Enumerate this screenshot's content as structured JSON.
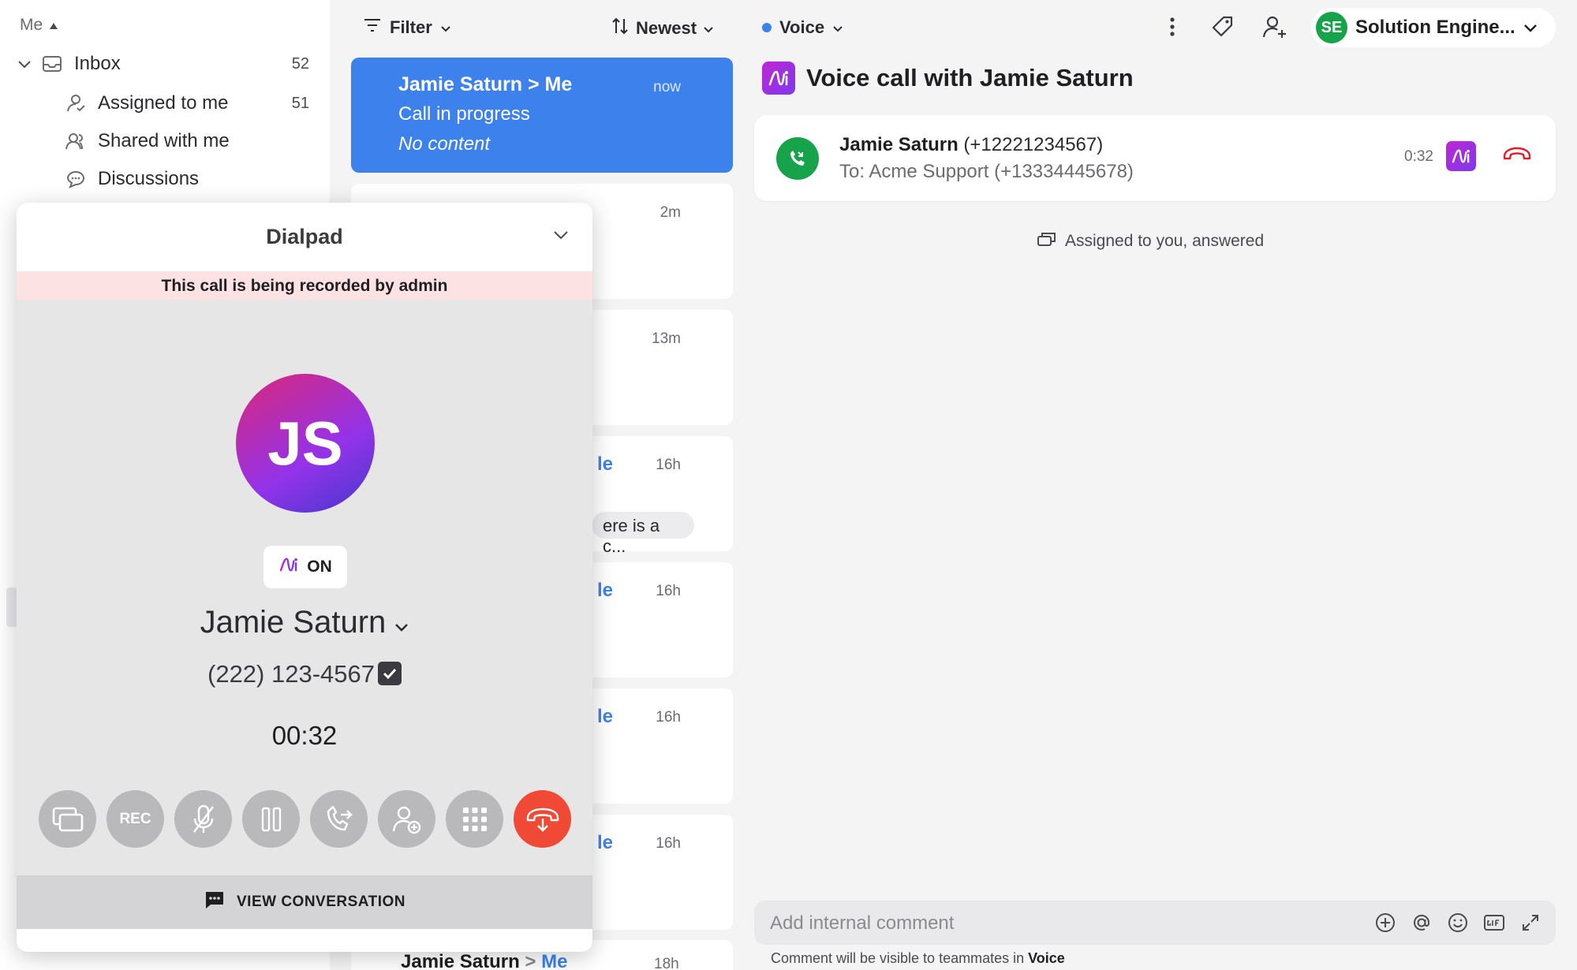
{
  "sidebar": {
    "me_label": "Me",
    "inbox": {
      "label": "Inbox",
      "count": "52"
    },
    "items": [
      {
        "label": "Assigned to me",
        "count": "51"
      },
      {
        "label": "Shared with me",
        "count": ""
      },
      {
        "label": "Discussions",
        "count": ""
      }
    ]
  },
  "list": {
    "filter_label": "Filter",
    "sort_label": "Newest",
    "active_card": {
      "title": "Jamie Saturn > Me",
      "subtitle": "Call in progress",
      "body": "No content",
      "time": "now"
    },
    "cards": [
      {
        "time": "2m",
        "fragment": ""
      },
      {
        "time": "13m",
        "fragment": ""
      },
      {
        "time": "16h",
        "fragment": "le",
        "pill": "ere is a c..."
      },
      {
        "time": "16h",
        "fragment": "le"
      },
      {
        "time": "16h",
        "fragment": "le"
      },
      {
        "time": "16h",
        "fragment": "le"
      }
    ],
    "last_row": {
      "name": "Jamie Saturn",
      "sep": " > ",
      "me": "Me",
      "time": "18h"
    }
  },
  "pane": {
    "inbox_filter": "Voice",
    "account_initials": "SE",
    "account_name": "Solution Engine...",
    "title": "Voice call with Jamie Saturn",
    "call": {
      "caller_name": "Jamie Saturn",
      "caller_number": "(+12221234567)",
      "callee": "To: Acme Support (+13334445678)",
      "duration": "0:32"
    },
    "assigned_text": "Assigned to you, answered",
    "comment_placeholder": "Add internal comment",
    "comment_hint_prefix": "Comment will be visible to teammates in ",
    "comment_hint_inbox": "Voice"
  },
  "dialpad": {
    "title": "Dialpad",
    "recording_banner": "This call is being recorded by admin",
    "avatar_initials": "JS",
    "ai_status": "ON",
    "contact_name": "Jamie Saturn",
    "contact_number": "(222) 123-4567",
    "timer": "00:32",
    "controls": [
      "transfer-screens",
      "REC",
      "mute",
      "hold",
      "forward",
      "add-participant",
      "keypad",
      "end-call"
    ],
    "footer_label": "VIEW CONVERSATION"
  },
  "colors": {
    "accent": "#3d82ec",
    "call_green": "#16a34a",
    "end_call_red": "#f04a36",
    "ai_gradient_start": "#c026d3",
    "ai_gradient_end": "#7c3aed"
  }
}
